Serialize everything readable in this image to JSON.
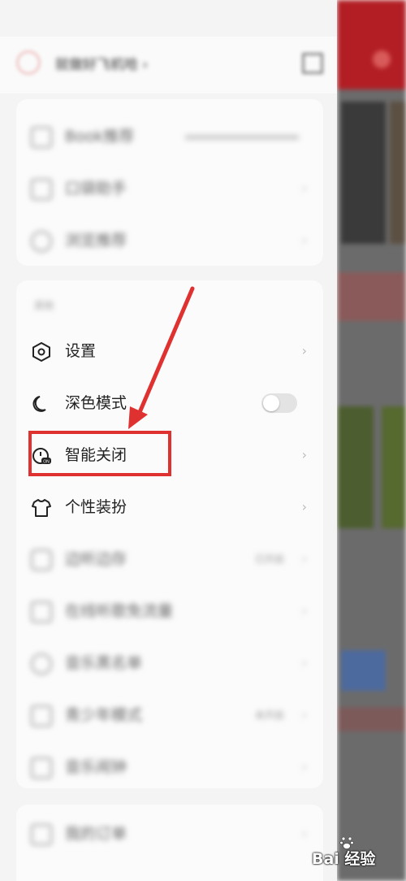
{
  "header": {
    "user_name": "就做好飞机哈",
    "user_name_suffix": "›"
  },
  "top_card": {
    "items": [
      {
        "label": "Book推荐",
        "sub": "",
        "icon": "book-icon"
      },
      {
        "label": "口袋助手",
        "sub": "",
        "icon": "pocket-icon"
      },
      {
        "label": "浏览推荐",
        "sub": "",
        "icon": "browse-icon"
      }
    ]
  },
  "settings_section": {
    "title": "其他",
    "items": [
      {
        "label": "设置",
        "icon": "settings-hexagon-icon"
      },
      {
        "label": "深色模式",
        "icon": "moon-icon",
        "toggle": false
      },
      {
        "label": "智能关闭",
        "icon": "timer-off-icon"
      },
      {
        "label": "个性装扮",
        "icon": "tshirt-icon"
      }
    ],
    "blurred_items": [
      {
        "label": "边听边存",
        "sub": "已开启",
        "icon": "headphones-icon"
      },
      {
        "label": "在线听歌免流量",
        "sub": "",
        "icon": "data-icon"
      },
      {
        "label": "音乐黑名单",
        "sub": "",
        "icon": "blacklist-icon"
      },
      {
        "label": "青少年模式",
        "sub": "未开启",
        "icon": "teen-icon"
      },
      {
        "label": "音乐闹钟",
        "sub": "",
        "icon": "alarm-icon"
      }
    ]
  },
  "bottom_card": {
    "items": [
      {
        "label": "我的订单",
        "icon": "order-icon"
      }
    ]
  },
  "colors": {
    "highlight": "#e03131",
    "drawer_bg": "#f4f4f4",
    "card_bg": "#fbfbfb",
    "accent_red": "#c3242c"
  },
  "watermark": {
    "text": "Bai 经验",
    "brand": "du"
  }
}
